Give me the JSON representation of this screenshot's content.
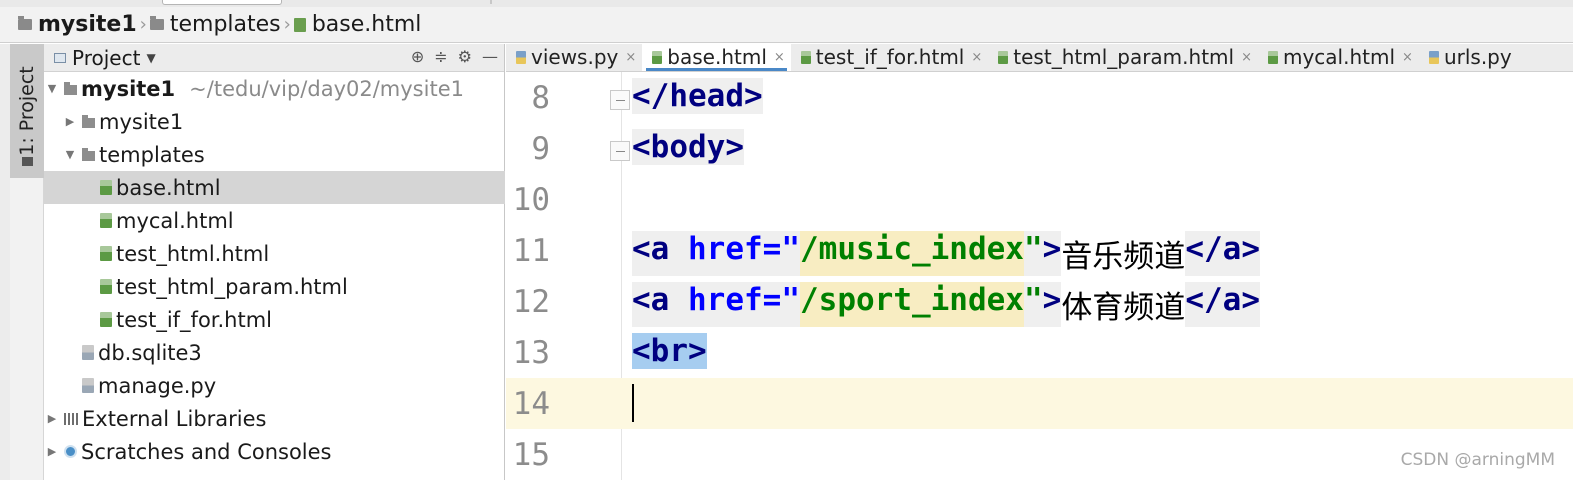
{
  "breadcrumb": {
    "items": [
      {
        "label": "mysite1",
        "icon": "folder-icon"
      },
      {
        "label": "templates",
        "icon": "folder-icon"
      },
      {
        "label": "base.html",
        "icon": "html-file-icon"
      }
    ]
  },
  "side_tool": {
    "label": "1: Project"
  },
  "project_panel": {
    "title": "Project",
    "tree": [
      {
        "label": "mysite1",
        "extra": "~/tedu/vip/day02/mysite1",
        "icon": "folder-icon",
        "expanded": true
      },
      {
        "label": "mysite1",
        "icon": "folder-icon",
        "expanded": false
      },
      {
        "label": "templates",
        "icon": "folder-icon",
        "expanded": true
      },
      {
        "label": "base.html",
        "icon": "html-file-icon",
        "selected": true
      },
      {
        "label": "mycal.html",
        "icon": "html-file-icon"
      },
      {
        "label": "test_html.html",
        "icon": "html-file-icon"
      },
      {
        "label": "test_html_param.html",
        "icon": "html-file-icon"
      },
      {
        "label": "test_if_for.html",
        "icon": "html-file-icon"
      },
      {
        "label": "db.sqlite3",
        "icon": "file-icon"
      },
      {
        "label": "manage.py",
        "icon": "python-file-icon"
      },
      {
        "label": "External Libraries",
        "icon": "libraries-icon",
        "expanded": false
      },
      {
        "label": "Scratches and Consoles",
        "icon": "scratches-icon",
        "expanded": false
      }
    ]
  },
  "editor_tabs": [
    {
      "label": "views.py",
      "icon": "python-file-icon"
    },
    {
      "label": "base.html",
      "icon": "html-file-icon",
      "active": true
    },
    {
      "label": "test_if_for.html",
      "icon": "html-file-icon"
    },
    {
      "label": "test_html_param.html",
      "icon": "html-file-icon"
    },
    {
      "label": "mycal.html",
      "icon": "html-file-icon"
    },
    {
      "label": "urls.py",
      "icon": "python-file-icon"
    }
  ],
  "editor": {
    "line_numbers": [
      "8",
      "9",
      "10",
      "11",
      "12",
      "13",
      "14",
      "15"
    ],
    "lines": {
      "l8": {
        "open": "</",
        "tag": "head",
        "close": ">"
      },
      "l9": {
        "open": "<",
        "tag": "body",
        "close": ">"
      },
      "l11": {
        "open": "<",
        "tag": "a",
        "attr": "href",
        "eq": "=\"",
        "value": "/music_index",
        "quote": "\"",
        "close": ">",
        "text": "音乐频道",
        "end_open": "</",
        "end_tag": "a",
        "end_close": ">"
      },
      "l12": {
        "open": "<",
        "tag": "a",
        "attr": "href",
        "eq": "=\"",
        "value": "/sport_index",
        "quote": "\"",
        "close": ">",
        "text": "体育频道",
        "end_open": "</",
        "end_tag": "a",
        "end_close": ">"
      },
      "l13": {
        "open": "<",
        "tag": "br",
        "close": ">"
      }
    },
    "current_line": "14"
  },
  "watermark": "CSDN @arningMM",
  "colors": {
    "tag": "#000080",
    "attribute": "#0000ff",
    "string": "#008000",
    "selection": "#a6cdf0",
    "current_line": "#fdf8e0"
  }
}
